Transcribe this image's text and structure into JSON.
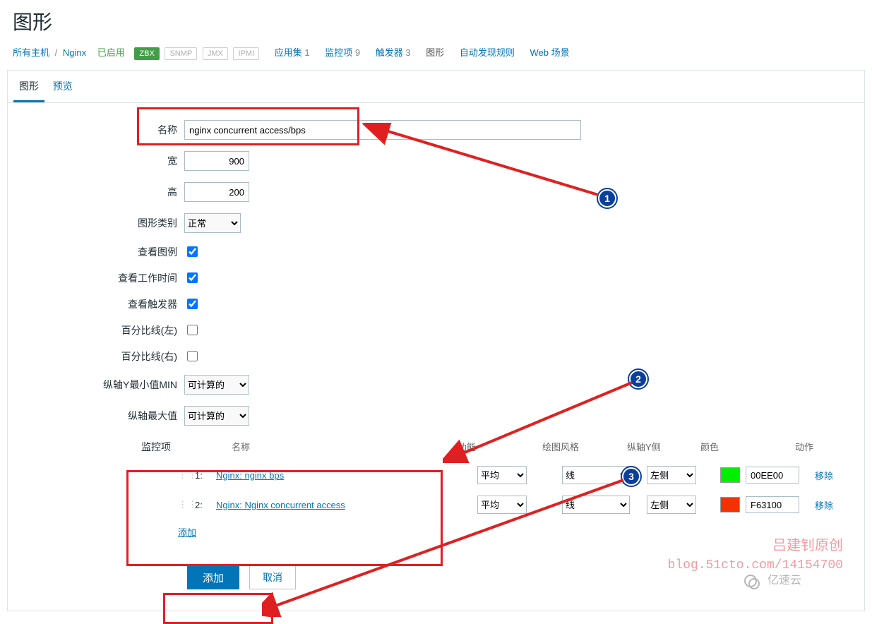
{
  "header": {
    "page_title": "图形"
  },
  "crumbs": {
    "all_hosts": "所有主机",
    "host": "Nginx",
    "status": "已启用",
    "badges": {
      "zbx": "ZBX",
      "snmp": "SNMP",
      "jmx": "JMX",
      "ipmi": "IPMI"
    },
    "nav": {
      "app": {
        "label": "应用集",
        "count": "1"
      },
      "items": {
        "label": "监控项",
        "count": "9"
      },
      "trig": {
        "label": "触发器",
        "count": "3"
      },
      "graph": {
        "label": "图形"
      },
      "disc": {
        "label": "自动发现规则"
      },
      "web": {
        "label": "Web 场景"
      }
    }
  },
  "tabs": {
    "graph": "图形",
    "preview": "预览"
  },
  "form": {
    "labels": {
      "name": "名称",
      "width": "宽",
      "height": "高",
      "type": "图形类别",
      "show_legend": "查看图例",
      "show_work": "查看工作时间",
      "show_trig": "查看触发器",
      "pct_left": "百分比线(左)",
      "pct_right": "百分比线(右)",
      "ymin": "纵轴Y最小值MIN",
      "ymax": "纵轴最大值",
      "items": "监控项"
    },
    "name_value": "nginx concurrent access/bps",
    "width_value": "900",
    "height_value": "200",
    "type_value": "正常",
    "ymin_value": "可计算的",
    "ymax_value": "可计算的",
    "check": {
      "legend": true,
      "work": true,
      "trig": true,
      "pleft": false,
      "pright": false
    }
  },
  "items": {
    "headers": {
      "name": "名称",
      "func": "功能",
      "style": "绘图风格",
      "side": "纵轴Y侧",
      "color": "颜色",
      "action": "动作"
    },
    "rows": [
      {
        "idx": "1:",
        "name": "Nginx: nginx bps",
        "func": "平均",
        "style": "线",
        "side": "左侧",
        "color": "00EE00",
        "swatch": "#00EE00",
        "action": "移除"
      },
      {
        "idx": "2:",
        "name": "Nginx: Nginx concurrent access",
        "func": "平均",
        "style": "线",
        "side": "左侧",
        "color": "F63100",
        "swatch": "#F63100",
        "action": "移除"
      }
    ],
    "add_link": "添加"
  },
  "buttons": {
    "submit": "添加",
    "cancel": "取消"
  },
  "watermark": {
    "line1": "吕建钊原创",
    "line2": "blog.51cto.com/14154700"
  },
  "footer_badge": "亿速云"
}
